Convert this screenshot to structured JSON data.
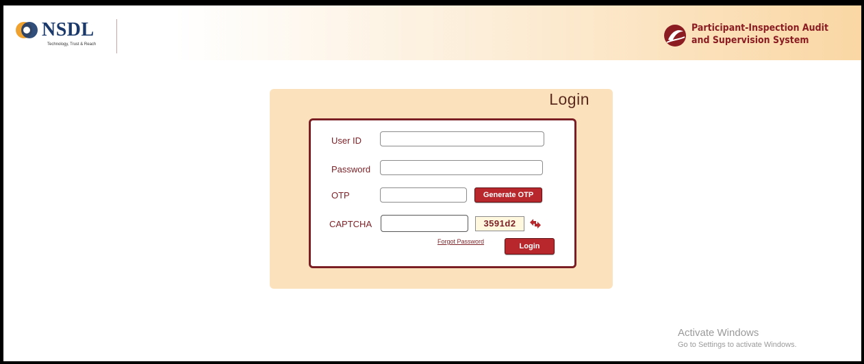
{
  "header": {
    "logo_text": "NSDL",
    "logo_tagline": "Technology, Trust & Reach",
    "system_title_line1": "Participant-Inspection Audit",
    "system_title_line2": "and Supervision System"
  },
  "login": {
    "heading": "Login",
    "user_id_label": "User ID",
    "user_id_value": "",
    "password_label": "Password",
    "password_value": "",
    "otp_label": "OTP",
    "otp_value": "",
    "generate_otp_label": "Generate OTP",
    "captcha_label": "CAPTCHA",
    "captcha_value": "",
    "captcha_code": "3591d2",
    "forgot_password_label": "Forgot Password",
    "login_button_label": "Login"
  },
  "watermark": {
    "line1": "Activate Windows",
    "line2": "Go to Settings to activate Windows."
  },
  "colors": {
    "brand_red": "#b8272c",
    "panel_bg": "#fbe2bd",
    "border_maroon": "#7a1e24",
    "nsdl_blue": "#1b3a6b"
  }
}
